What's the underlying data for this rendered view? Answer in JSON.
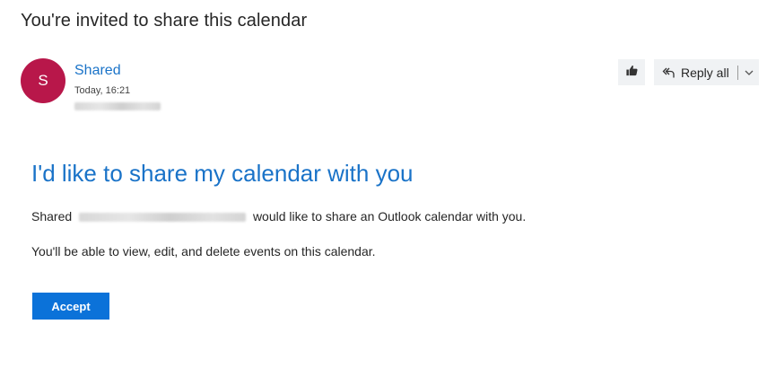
{
  "message": {
    "subject": "You're invited to share this calendar",
    "sender": {
      "initial": "S",
      "name": "Shared",
      "avatar_color": "#b8174a"
    },
    "date": "Today, 16:21"
  },
  "toolbar": {
    "like_icon": "thumbs-up-icon",
    "reply_all_label": "Reply all",
    "reply_icon": "reply-all-icon",
    "more_icon": "chevron-down-icon"
  },
  "body": {
    "heading": "I'd like to share my calendar with you",
    "intro_prefix": "Shared",
    "intro_suffix": "would like to share an Outlook calendar with you.",
    "permissions": "You'll be able to view, edit, and delete events on this calendar.",
    "accept_label": "Accept"
  },
  "colors": {
    "accent": "#1a73c8",
    "button": "#0b72d9"
  }
}
